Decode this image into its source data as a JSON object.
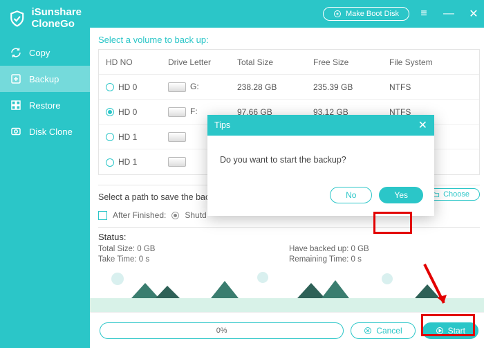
{
  "app": {
    "name_line1": "iSunshare",
    "name_line2": "CloneGo"
  },
  "titlebar": {
    "boot_label": "Make Boot Disk"
  },
  "sidebar": {
    "items": [
      {
        "label": "Copy"
      },
      {
        "label": "Backup"
      },
      {
        "label": "Restore"
      },
      {
        "label": "Disk Clone"
      }
    ]
  },
  "volume": {
    "title": "Select a volume to back up:",
    "headers": {
      "hdno": "HD NO",
      "letter": "Drive Letter",
      "total": "Total Size",
      "free": "Free Size",
      "fs": "File System"
    },
    "rows": [
      {
        "hd": "HD 0",
        "letter": "G:",
        "total": "238.28 GB",
        "free": "235.39 GB",
        "fs": "NTFS",
        "selected": false
      },
      {
        "hd": "HD 0",
        "letter": "F:",
        "total": "97.66 GB",
        "free": "93.12 GB",
        "fs": "NTFS",
        "selected": true
      },
      {
        "hd": "HD 1",
        "letter": "",
        "total": "",
        "free": "",
        "fs": "",
        "selected": false
      },
      {
        "hd": "HD 1",
        "letter": "",
        "total": "",
        "free": "",
        "fs": "",
        "selected": false
      }
    ]
  },
  "path": {
    "title_visible": "Select a path to save the back",
    "choose_label": "Choose",
    "after_label": "After Finished:",
    "opt_shutdown_visible": "Shutd"
  },
  "status": {
    "title": "Status:",
    "total": "Total Size: 0 GB",
    "backed": "Have backed up: 0 GB",
    "take": "Take Time: 0 s",
    "remain": "Remaining Time: 0 s"
  },
  "footer": {
    "progress_text": "0%",
    "cancel_label": "Cancel",
    "start_label": "Start"
  },
  "dialog": {
    "title": "Tips",
    "message": "Do you want to start the backup?",
    "no_label": "No",
    "yes_label": "Yes"
  },
  "colors": {
    "accent": "#2bc6c8",
    "highlight": "#e20000"
  }
}
